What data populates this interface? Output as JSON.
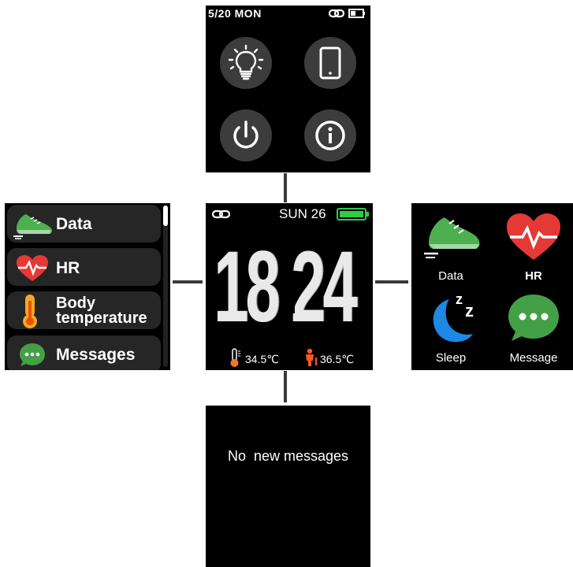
{
  "top_screen": {
    "status_date": "5/20 MON",
    "icons": [
      "link-icon",
      "battery-icon",
      "brightness-icon",
      "phone-icon",
      "power-icon",
      "info-icon"
    ]
  },
  "center_screen": {
    "date": "SUN 26",
    "time_hours": "18",
    "time_minutes": "24",
    "temp_ambient": "34.5℃",
    "temp_body": "36.5℃",
    "battery_color": "#2ecc40"
  },
  "left_screen": {
    "items": [
      {
        "label": "Data",
        "icon": "shoe-icon"
      },
      {
        "label": "HR",
        "icon": "heart-icon"
      },
      {
        "label_line1": "Body",
        "label_line2": "temperature",
        "icon": "thermometer-icon"
      },
      {
        "label": "Messages",
        "icon": "message-icon"
      }
    ]
  },
  "right_screen": {
    "apps": [
      {
        "label": "Data",
        "icon": "shoe-icon"
      },
      {
        "label": "HR",
        "icon": "heart-icon"
      },
      {
        "label": "Sleep",
        "icon": "moon-icon"
      },
      {
        "label": "Message",
        "icon": "message-icon"
      }
    ]
  },
  "bottom_screen": {
    "message": "No  new messages"
  }
}
